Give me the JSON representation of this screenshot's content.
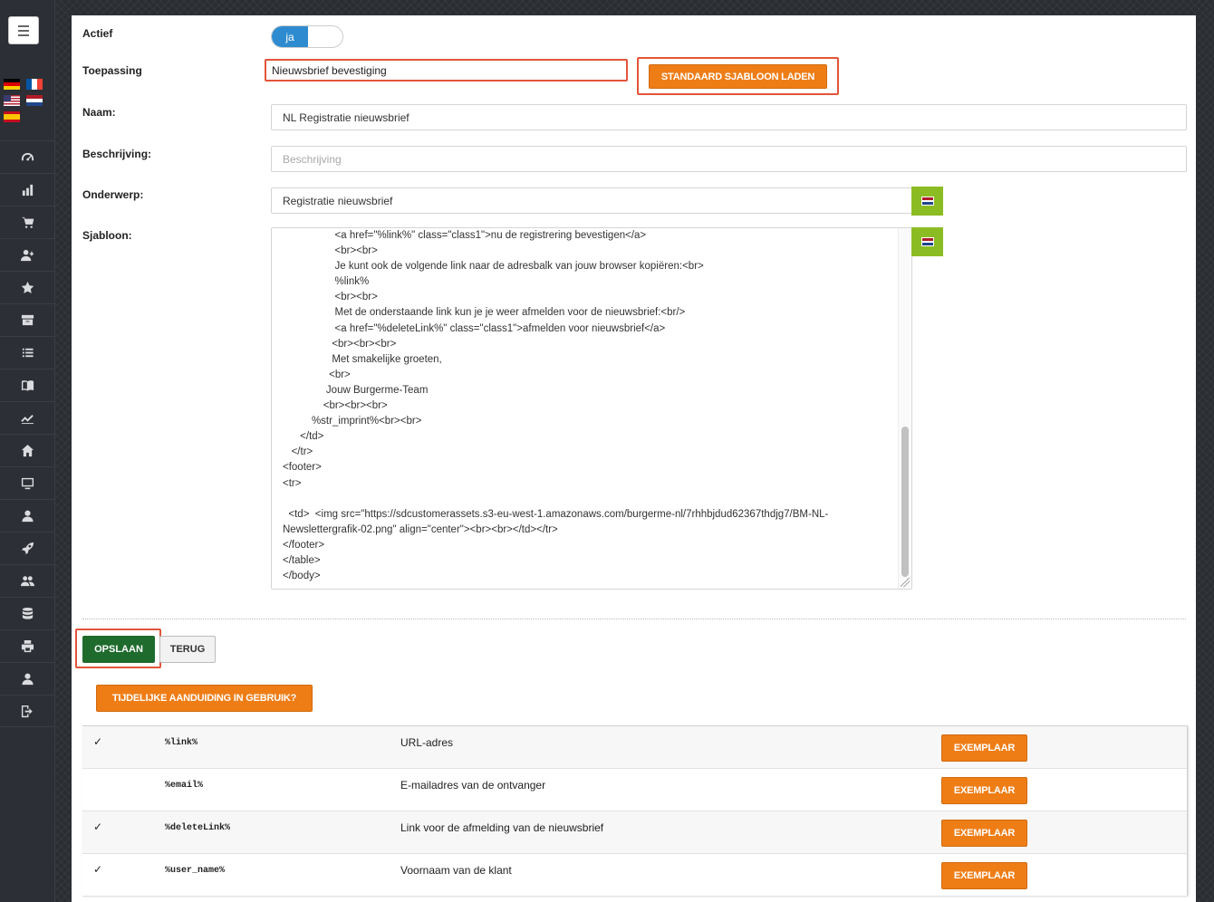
{
  "sidebar": {
    "menu_icon": "hamburger-icon",
    "languages": [
      "de",
      "fr",
      "us",
      "nl",
      "es"
    ],
    "nav_icons": [
      "dashboard-icon",
      "bar-chart-icon",
      "cart-icon",
      "add-user-icon",
      "star-icon",
      "archive-icon",
      "list-icon",
      "book-icon",
      "line-chart-icon",
      "home-icon",
      "monitor-icon",
      "user-icon",
      "rocket-icon",
      "users-icon",
      "database-icon",
      "print-icon",
      "user-icon",
      "logout-icon"
    ]
  },
  "form": {
    "active_label": "Actief",
    "active_value": "ja",
    "application_label": "Toepassing",
    "application_value": "Nieuwsbrief bevestiging",
    "load_template_button": "STANDAARD SJABLOON LADEN",
    "name_label": "Naam:",
    "name_value": "NL Registratie nieuwsbrief",
    "description_label": "Beschrijving:",
    "description_placeholder": "Beschrijving",
    "subject_label": "Onderwerp:",
    "subject_value": "Registratie nieuwsbrief",
    "template_label": "Sjabloon:",
    "template_lines": [
      "                  <a href=\"%link%\" class=\"class1\">nu de registrering bevestigen</a>",
      "                  <br><br>",
      "                  Je kunt ook de volgende link naar de adresbalk van jouw browser kopiëren:<br>",
      "                  %link%",
      "                  <br><br>",
      "                  Met de onderstaande link kun je je weer afmelden voor de nieuwsbrief:<br/>",
      "                  <a href=\"%deleteLink%\" class=\"class1\">afmelden voor nieuwsbrief</a>",
      "                 <br><br><br>",
      "                 Met smakelijke groeten,",
      "                <br>",
      "               Jouw Burgerme-Team",
      "              <br><br><br>",
      "          %str_imprint%<br><br>",
      "      </td>",
      "   </tr>",
      "<footer>",
      "<tr>",
      "",
      "  <td>  <img src=\"https://sdcustomerassets.s3-eu-west-1.amazonaws.com/burgerme-nl/7rhhbjdud62367thdjg7/BM-NL-",
      "Newslettergrafik-02.png\" align=\"center\"><br><br></td></tr>",
      "</footer>",
      "</table>",
      "</body>"
    ]
  },
  "actions": {
    "save_label": "OPSLAAN",
    "back_label": "TERUG",
    "placeholders_button": "TIJDELIJKE AANDUIDING IN GEBRUIK?"
  },
  "placeholders": [
    {
      "checked": "✓",
      "code": "%link%",
      "description": "URL-adres",
      "button": "EXEMPLAAR"
    },
    {
      "checked": "",
      "code": "%email%",
      "description": "E-mailadres van de ontvanger",
      "button": "EXEMPLAAR"
    },
    {
      "checked": "✓",
      "code": "%deleteLink%",
      "description": "Link voor de afmelding van de nieuwsbrief",
      "button": "EXEMPLAAR"
    },
    {
      "checked": "✓",
      "code": "%user_name%",
      "description": "Voornaam van de klant",
      "button": "EXEMPLAAR"
    }
  ],
  "colors": {
    "accent_orange": "#ef7d16",
    "save_green": "#1f6b2e",
    "toggle_blue": "#2f8bd0",
    "flag_button_green": "#8cbc23",
    "highlight_red": "#e2553a"
  }
}
